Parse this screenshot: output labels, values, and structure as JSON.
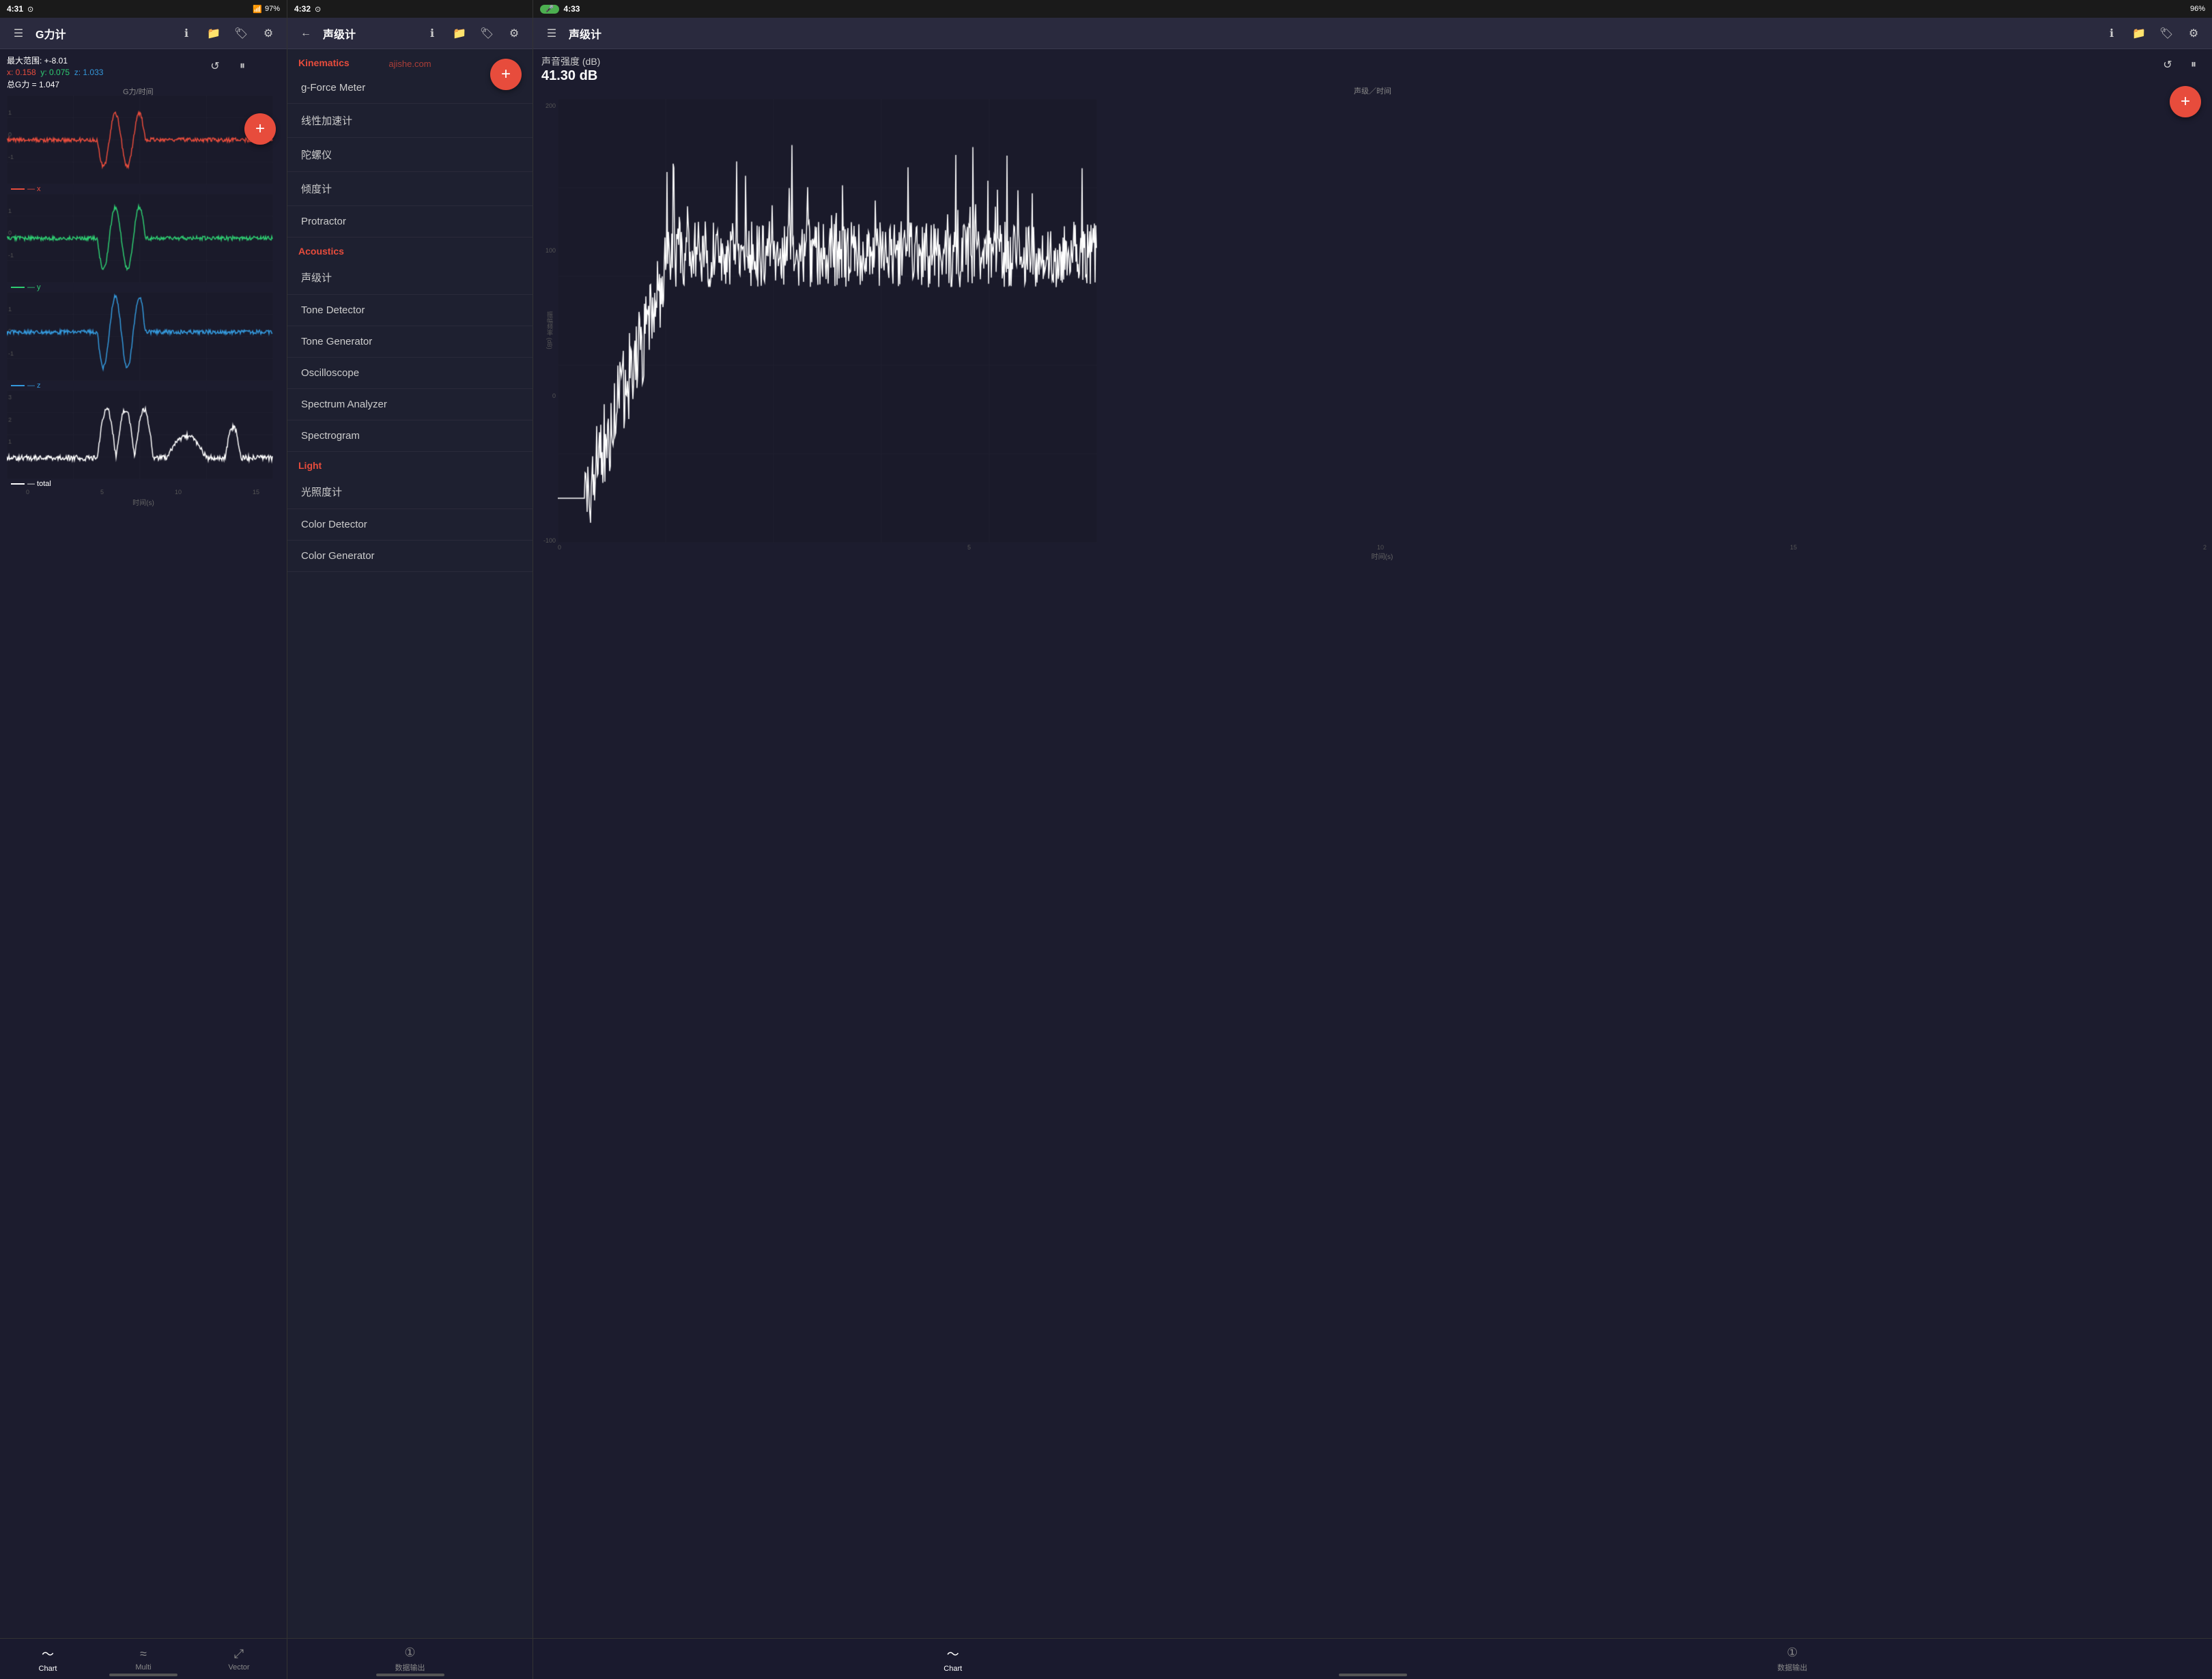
{
  "statusBars": [
    {
      "time": "4:31",
      "leftIcons": "⊙",
      "battery": "97%",
      "batteryIcon": "🔋"
    },
    {
      "time": "4:32",
      "leftIcons": "⊙"
    },
    {
      "time": "4:33",
      "battery": "96%"
    }
  ],
  "panel1": {
    "title": "G力计",
    "stats": {
      "range": "最大范围: +-8.01",
      "xyz": "x: 0.158  y: 0.075  z: 1.033",
      "total": "总G力 = 1.047"
    },
    "chartTitle": "G力/时间",
    "timeAxisLabel": "时间(s)",
    "legends": [
      {
        "label": "—x",
        "color": "#e74c3c"
      },
      {
        "label": "—y",
        "color": "#2ecc71"
      },
      {
        "label": "—z",
        "color": "#3498db"
      },
      {
        "label": "—total",
        "color": "#ffffff"
      }
    ],
    "nav": {
      "items": [
        {
          "label": "Chart",
          "icon": "〜",
          "active": true
        },
        {
          "label": "Multi",
          "icon": "≈"
        },
        {
          "label": "Vector",
          "icon": "⤢"
        }
      ]
    }
  },
  "panel2": {
    "appBarTitle": "声级计",
    "menu": {
      "sections": [
        {
          "header": "Kinematics",
          "headerColor": "#e74c3c",
          "items": [
            {
              "label": "g-Force Meter",
              "active": false
            },
            {
              "label": "线性加速计",
              "active": false
            },
            {
              "label": "陀螺仪",
              "active": false
            },
            {
              "label": "倾度计",
              "active": false
            },
            {
              "label": "Protractor",
              "active": false
            }
          ]
        },
        {
          "header": "Acoustics",
          "headerColor": "#e74c3c",
          "items": [
            {
              "label": "声级计",
              "active": false
            },
            {
              "label": "Tone Detector",
              "active": false
            },
            {
              "label": "Tone Generator",
              "active": false
            },
            {
              "label": "Oscilloscope",
              "active": false
            },
            {
              "label": "Spectrum Analyzer",
              "active": false
            },
            {
              "label": "Spectrogram",
              "active": false
            }
          ]
        },
        {
          "header": "Light",
          "headerColor": "#e74c3c",
          "items": [
            {
              "label": "光照度计",
              "active": false
            },
            {
              "label": "Color Detector",
              "active": false
            },
            {
              "label": "Color Generator",
              "active": false
            }
          ]
        }
      ]
    },
    "nav": {
      "items": [
        {
          "label": "数据输出",
          "icon": "①"
        }
      ]
    }
  },
  "panel3": {
    "appBarTitle": "声级计",
    "stats": {
      "title": "声音强度 (dB)",
      "value": "41.30 dB",
      "chartLabel": "声级／时间"
    },
    "yAxisLabels": [
      "200",
      "100",
      "0",
      "-100"
    ],
    "xAxisLabels": [
      "0",
      "5",
      "10",
      "15",
      "2"
    ],
    "yAxisTitle": "振幅频率 (dB)",
    "nav": {
      "items": [
        {
          "label": "Chart",
          "icon": "〜",
          "active": true
        },
        {
          "label": "数据输出",
          "icon": "①"
        }
      ]
    }
  }
}
